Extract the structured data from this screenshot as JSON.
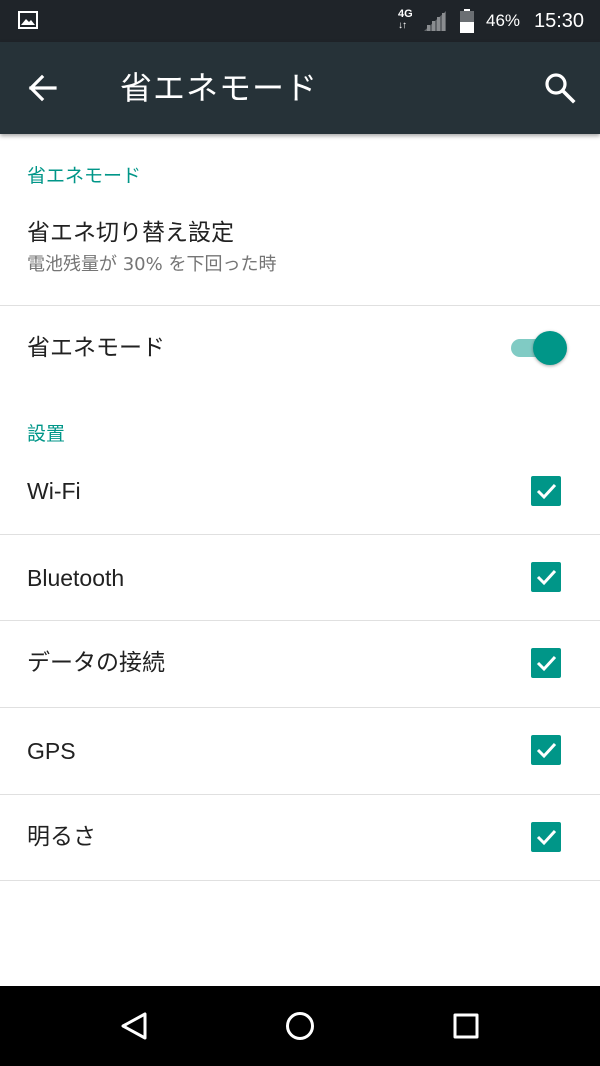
{
  "status_bar": {
    "network": "4G",
    "network_arrows": "↓↑",
    "battery": "46%",
    "time": "15:30",
    "icons": [
      "image-notification-icon",
      "cell-signal-icon",
      "battery-icon"
    ]
  },
  "app_bar": {
    "title": "省エネモード",
    "icons": [
      "back-arrow-icon",
      "search-icon"
    ]
  },
  "section_power": {
    "header": "省エネモード",
    "switch_setting": {
      "title": "省エネ切り替え設定",
      "summary": "電池残量が 30% を下回った時"
    },
    "mode_toggle": {
      "label": "省エネモード",
      "on": true
    }
  },
  "section_settings": {
    "header": "設置",
    "items": [
      {
        "label": "Wi-Fi",
        "checked": true
      },
      {
        "label": "Bluetooth",
        "checked": true
      },
      {
        "label": "データの接続",
        "checked": true
      },
      {
        "label": "GPS",
        "checked": true
      },
      {
        "label": "明るさ",
        "checked": true
      }
    ]
  },
  "nav_bar": {
    "icons": [
      "back-triangle-icon",
      "home-circle-icon",
      "recents-square-icon"
    ]
  },
  "colors": {
    "accent": "#009688",
    "app_bar": "#263238",
    "status_bar": "#1f2429"
  }
}
